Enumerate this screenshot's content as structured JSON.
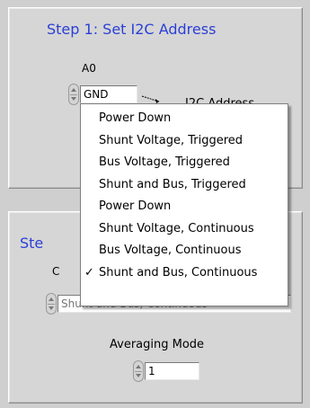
{
  "step1": {
    "title": "Step 1: Set I2C Address",
    "a0_label": "A0",
    "a0_value": "GND",
    "i2c_label": "I2C Address"
  },
  "step2": {
    "title_partial": "Ste",
    "mode_label_partial": "C",
    "mode_value_partial": "Shunt and Bus, Continuous",
    "averaging_label": "Averaging Mode",
    "averaging_value": "1"
  },
  "dropdown": {
    "items": [
      {
        "label": "Power Down",
        "checked": false
      },
      {
        "label": "Shunt Voltage, Triggered",
        "checked": false
      },
      {
        "label": "Bus Voltage, Triggered",
        "checked": false
      },
      {
        "label": "Shunt and Bus, Triggered",
        "checked": false
      },
      {
        "label": "Power Down",
        "checked": false
      },
      {
        "label": "Shunt Voltage, Continuous",
        "checked": false
      },
      {
        "label": "Bus Voltage, Continuous",
        "checked": false
      },
      {
        "label": "Shunt and Bus, Continuous",
        "checked": true
      }
    ],
    "check_glyph": "✓"
  },
  "colors": {
    "title_blue": "#2b3fd6",
    "panel_bg": "#d6d6d6"
  }
}
